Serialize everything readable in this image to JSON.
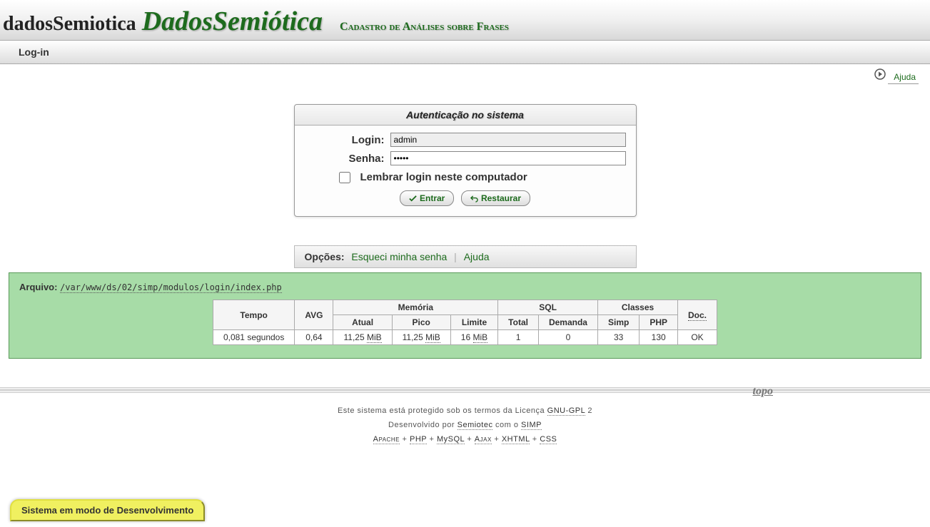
{
  "header": {
    "logo_small": "dadosSemiotica",
    "logo_big": "DadosSemiótica",
    "tagline": "Cadastro de Análises sobre Frases"
  },
  "menubar": {
    "login": "Log-in"
  },
  "toolbar": {
    "ajuda": "Ajuda"
  },
  "auth": {
    "title": "Autenticação no sistema",
    "login_label": "Login:",
    "login_value": "admin",
    "senha_label": "Senha:",
    "senha_value": "•••••",
    "remember_label": "Lembrar login neste computador",
    "entrar": "Entrar",
    "restaurar": "Restaurar"
  },
  "options": {
    "label": "Opções:",
    "esqueci": "Esqueci minha senha",
    "ajuda": "Ajuda"
  },
  "debug": {
    "arquivo_label": "Arquivo:",
    "arquivo_path": "/var/www/ds/02/simp/modulos/login/index.php",
    "headers": {
      "tempo": "Tempo",
      "avg": "AVG",
      "memoria": "Memória",
      "atual": "Atual",
      "pico": "Pico",
      "limite": "Limite",
      "sql": "SQL",
      "total": "Total",
      "demanda": "Demanda",
      "classes": "Classes",
      "simp": "Simp",
      "php": "PHP",
      "doc": "Doc."
    },
    "row": {
      "tempo": "0,081 segundos",
      "avg": "0,64",
      "atual_v": "11,25",
      "atual_u": "MiB",
      "pico_v": "11,25",
      "pico_u": "MiB",
      "limite_v": "16",
      "limite_u": "MiB",
      "total": "1",
      "demanda": "0",
      "simp": "33",
      "php": "130",
      "doc": "OK"
    }
  },
  "footer": {
    "topo": "topo",
    "line1_a": "Este sistema está protegido sob os termos da Licença ",
    "gnu": "GNU-GPL",
    "line1_b": " 2",
    "line2_a": "Desenvolvido por ",
    "semiotec": "Semiotec",
    "line2_b": " com o ",
    "simp": "SIMP",
    "apache": "Apache",
    "php": "PHP",
    "mysql": "MySQL",
    "ajax": "Ajax",
    "xhtml": "XHTML",
    "css": "CSS",
    "plus": " + "
  },
  "dev_badge": "Sistema em modo de Desenvolvimento"
}
